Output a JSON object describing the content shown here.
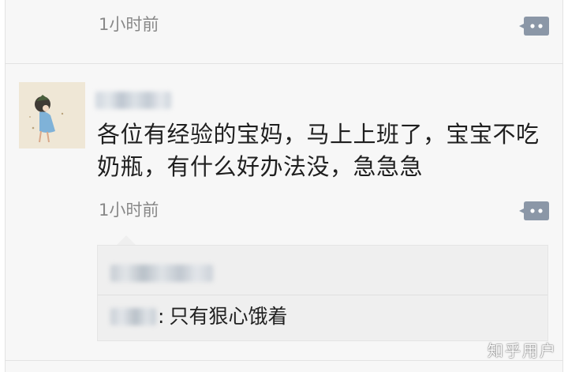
{
  "previous_item": {
    "time": "1小时前",
    "comment_icon": "comment-dots-icon"
  },
  "post": {
    "avatar_icon": "girl-with-umbrella-avatar",
    "text": "各位有经验的宝妈，马上上班了，宝宝不吃奶瓶，有什么好办法没，急急急",
    "time": "1小时前",
    "comment_icon": "comment-dots-icon"
  },
  "reply": {
    "separator": ":",
    "text": "只有狠心饿着"
  },
  "watermark": "知乎用户",
  "colors": {
    "background": "#f7f7f7",
    "comment_icon": "#8b97a7",
    "text": "#1f1f1f",
    "time": "#888888",
    "reply_bg": "#efefef"
  }
}
